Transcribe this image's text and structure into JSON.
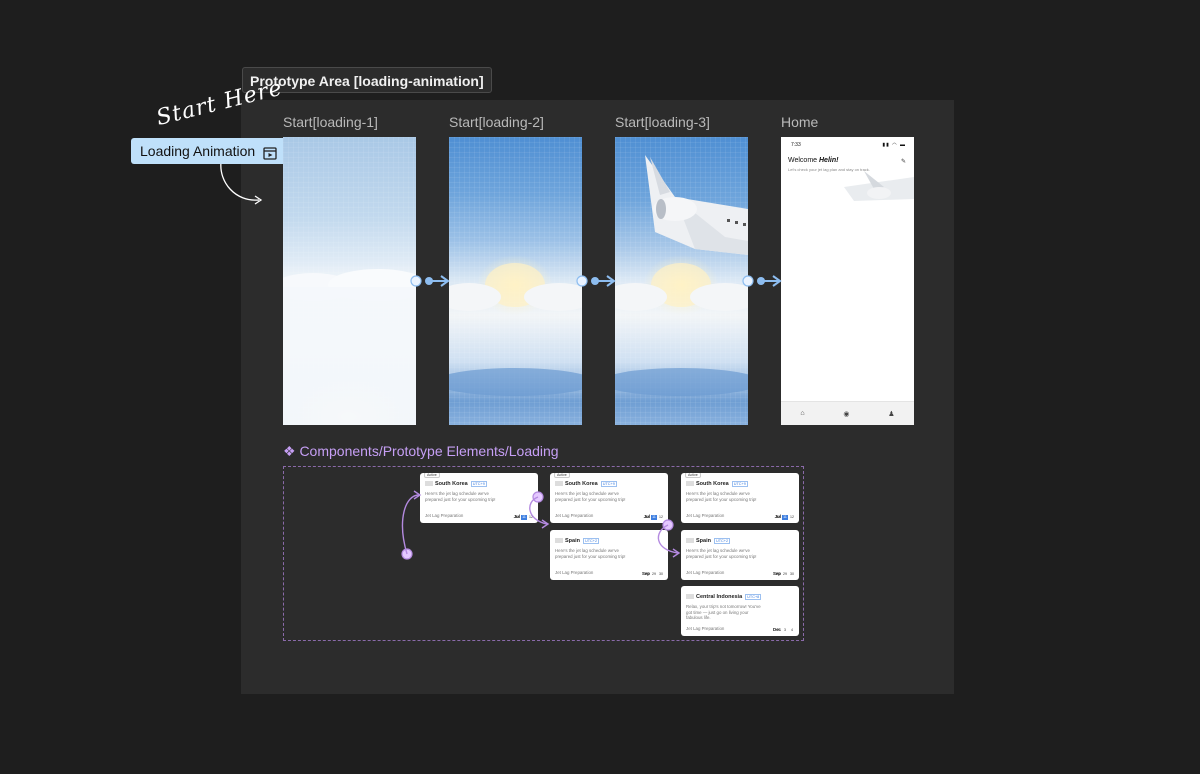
{
  "section": {
    "label": "Prototype Area [loading-animation]"
  },
  "flow": {
    "annotation": "Start Here",
    "start_label": "Loading Animation",
    "icon": "play-frame-icon"
  },
  "frames": [
    {
      "title": "Start[loading-1]"
    },
    {
      "title": "Start[loading-2]"
    },
    {
      "title": "Start[loading-3]"
    },
    {
      "title": "Home"
    }
  ],
  "home_screen": {
    "time": "7:33",
    "welcome": "Welcome",
    "name": "Helin!",
    "subtitle": "Let's check your jet lag plan and stay on track.",
    "nav_icons": [
      "home-icon",
      "globe-icon",
      "profile-icon"
    ]
  },
  "components": {
    "title": "❖ Components/Prototype Elements/Loading",
    "cards": [
      {
        "badge": "Active",
        "country": "South Korea",
        "utc": "UTC+9",
        "desc": "Here's the jet lag schedule we've prepared just for your upcoming trip!",
        "prep": "Jet Lag Preparation",
        "month": "Jul",
        "days": [
          "10",
          "11",
          "12"
        ],
        "selected": 1
      },
      {
        "badge": "Active",
        "country": "South Korea",
        "utc": "UTC+9",
        "desc": "Here's the jet lag schedule we've prepared just for your upcoming trip!",
        "prep": "Jet Lag Preparation",
        "month": "Jul",
        "days": [
          "10",
          "11",
          "12"
        ],
        "selected": 1
      },
      {
        "badge": "",
        "country": "Spain",
        "utc": "UTC+2",
        "desc": "Here's the jet lag schedule we've prepared just for your upcoming trip!",
        "prep": "Jet Lag Preparation",
        "month": "Sep",
        "days": [
          "28",
          "29",
          "30"
        ],
        "selected": -1
      },
      {
        "badge": "Active",
        "country": "South Korea",
        "utc": "UTC+9",
        "desc": "Here's the jet lag schedule we've prepared just for your upcoming trip!",
        "prep": "Jet Lag Preparation",
        "month": "Jul",
        "days": [
          "10",
          "11",
          "12"
        ],
        "selected": 1
      },
      {
        "badge": "",
        "country": "Spain",
        "utc": "UTC+2",
        "desc": "Here's the jet lag schedule we've prepared just for your upcoming trip!",
        "prep": "Jet Lag Preparation",
        "month": "Sep",
        "days": [
          "28",
          "29",
          "30"
        ],
        "selected": -1
      },
      {
        "badge": "",
        "country": "Central Indonesia",
        "utc": "UTC+8",
        "desc": "Relax, your trip's not tomorrow! You've got time — just go on living your fabulous life.",
        "prep": "Jet Lag Preparation",
        "month": "Dec",
        "days": [
          "2",
          "3",
          "4"
        ],
        "selected": -1
      }
    ]
  }
}
